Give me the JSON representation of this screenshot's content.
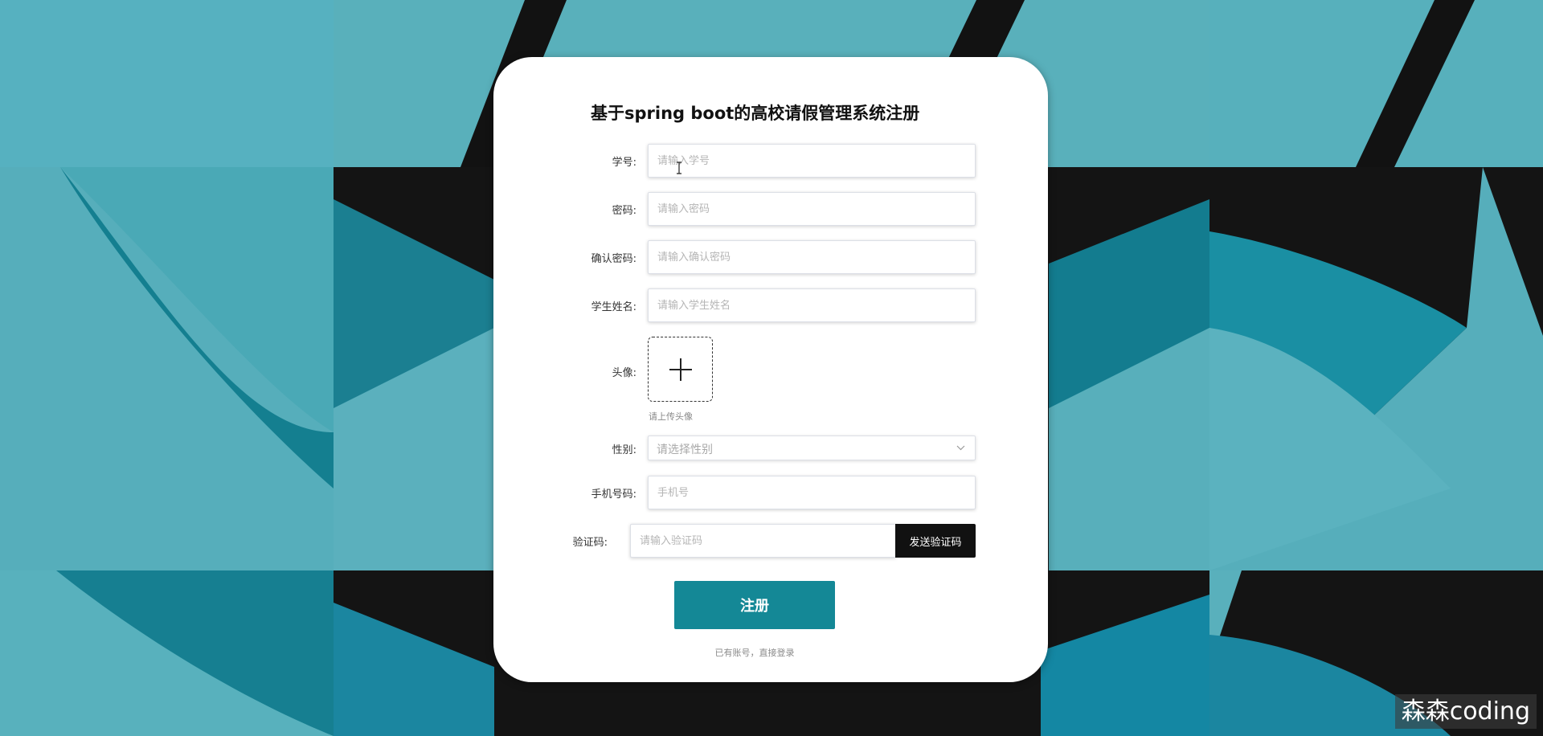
{
  "form": {
    "title": "基于spring boot的高校请假管理系统注册",
    "fields": [
      {
        "label": "学号:",
        "placeholder": "请输入学号",
        "value": ""
      },
      {
        "label": "密码:",
        "placeholder": "请输入密码",
        "value": ""
      },
      {
        "label": "确认密码:",
        "placeholder": "请输入确认密码",
        "value": ""
      },
      {
        "label": "学生姓名:",
        "placeholder": "请输入学生姓名",
        "value": ""
      }
    ],
    "avatar": {
      "label": "头像:",
      "tip": "请上传头像",
      "icon": "plus-icon"
    },
    "gender": {
      "label": "性别:",
      "placeholder": "请选择性别",
      "icon": "chevron-down-icon"
    },
    "phone": {
      "label": "手机号码:",
      "placeholder": "手机号",
      "value": ""
    },
    "code": {
      "label": "验证码:",
      "placeholder": "请输入验证码",
      "button": "发送验证码"
    },
    "submit": "注册",
    "login_link": "已有账号，直接登录"
  },
  "watermark": "森森coding",
  "colors": {
    "accent": "#148896",
    "code_button": "#111111",
    "background_teal": "#5ab0bc",
    "background_dark": "#141414"
  }
}
